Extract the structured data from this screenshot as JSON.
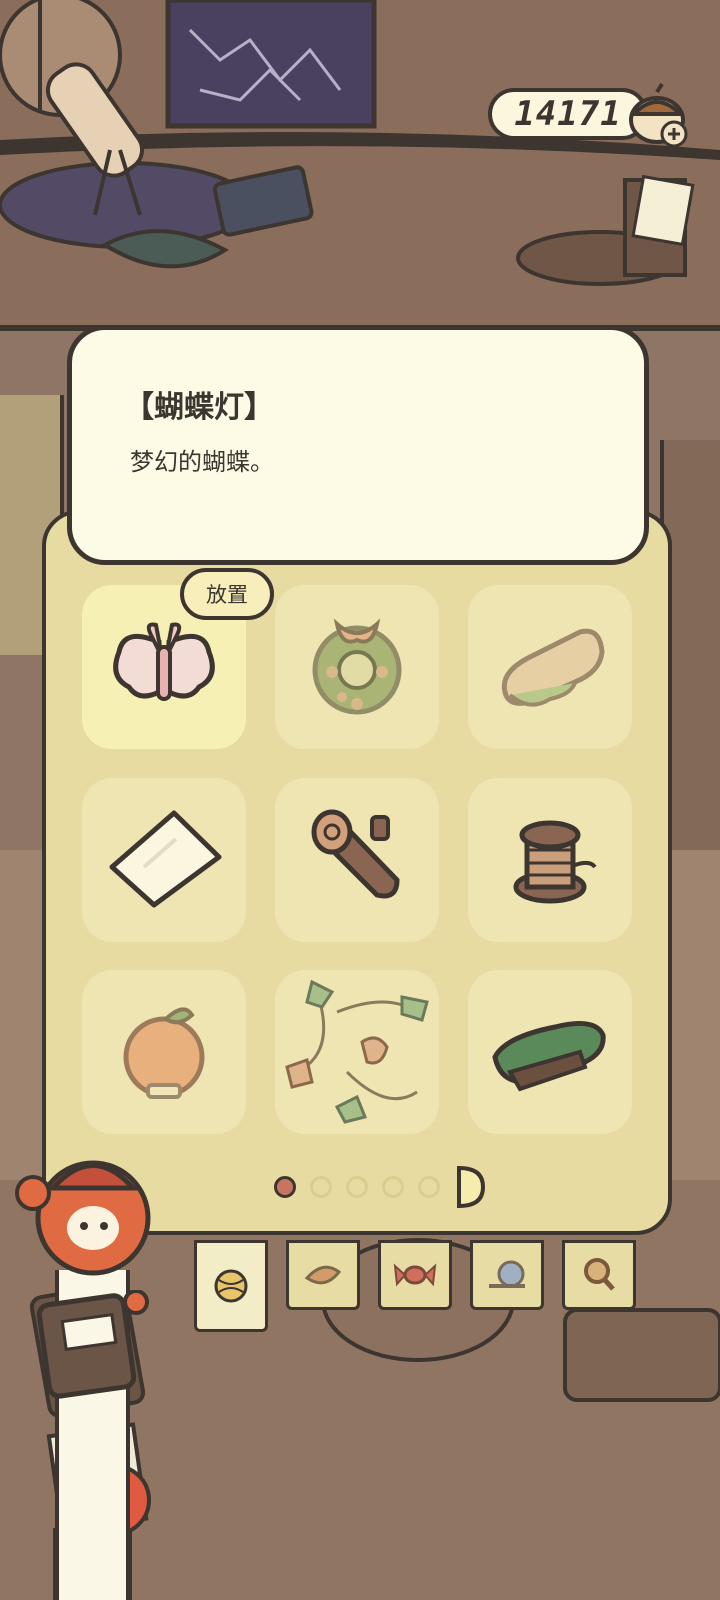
{
  "hud": {
    "coin_count": "14171",
    "coin_icon": "acorn-coin-icon",
    "add_icon": "plus-icon"
  },
  "description": {
    "title": "【蝴蝶灯】",
    "text": "梦幻的蝴蝶。"
  },
  "inventory": {
    "place_label": "放置",
    "items": [
      {
        "icon": "butterfly-lamp-icon",
        "selected": true
      },
      {
        "icon": "wreath-icon",
        "selected": false
      },
      {
        "icon": "bread-cushion-icon",
        "selected": false
      },
      {
        "icon": "glass-tile-icon",
        "selected": false
      },
      {
        "icon": "log-icon",
        "selected": false
      },
      {
        "icon": "thread-spool-icon",
        "selected": false
      },
      {
        "icon": "orange-fruit-icon",
        "selected": false
      },
      {
        "icon": "leaf-garland-icon",
        "selected": false
      },
      {
        "icon": "green-hat-icon",
        "selected": false
      }
    ],
    "pages": {
      "total": 5,
      "current": 1
    }
  },
  "tabs": [
    {
      "icon": "yarn-ball-icon",
      "active": true
    },
    {
      "icon": "leaf-icon",
      "active": false
    },
    {
      "icon": "candy-icon",
      "active": false
    },
    {
      "icon": "snail-icon",
      "active": false
    },
    {
      "icon": "magnifier-icon",
      "active": false
    }
  ],
  "colors": {
    "outline": "#3d3530",
    "panel": "#e7dba1",
    "card": "#fdfbe6",
    "active_dot": "#c77560"
  }
}
